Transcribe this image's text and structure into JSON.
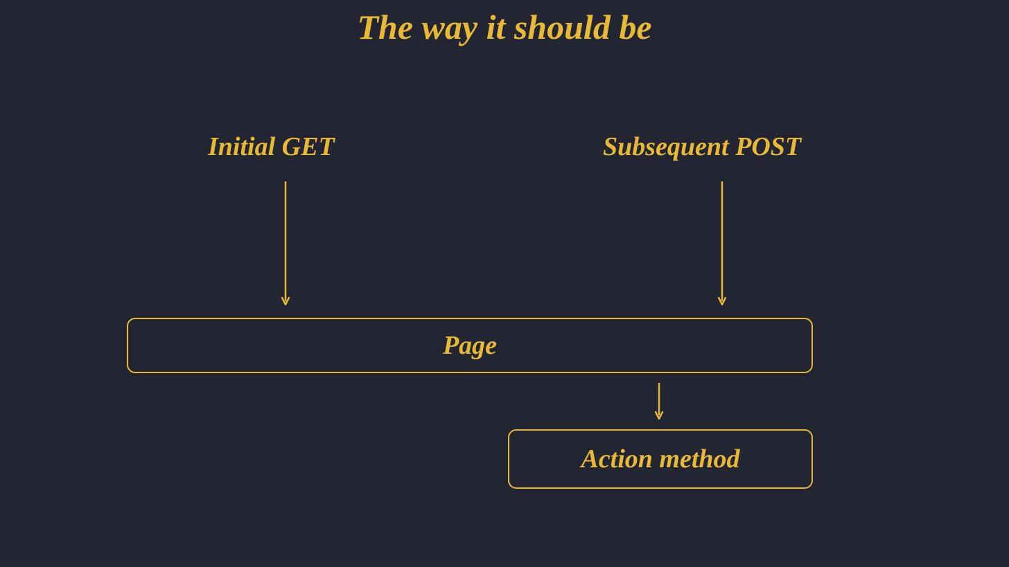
{
  "title": "The way it should be",
  "labels": {
    "initial_get": "Initial GET",
    "subsequent_post": "Subsequent POST"
  },
  "boxes": {
    "page": "Page",
    "action_method": "Action method"
  },
  "colors": {
    "background": "#232632",
    "accent": "#e8b936"
  }
}
